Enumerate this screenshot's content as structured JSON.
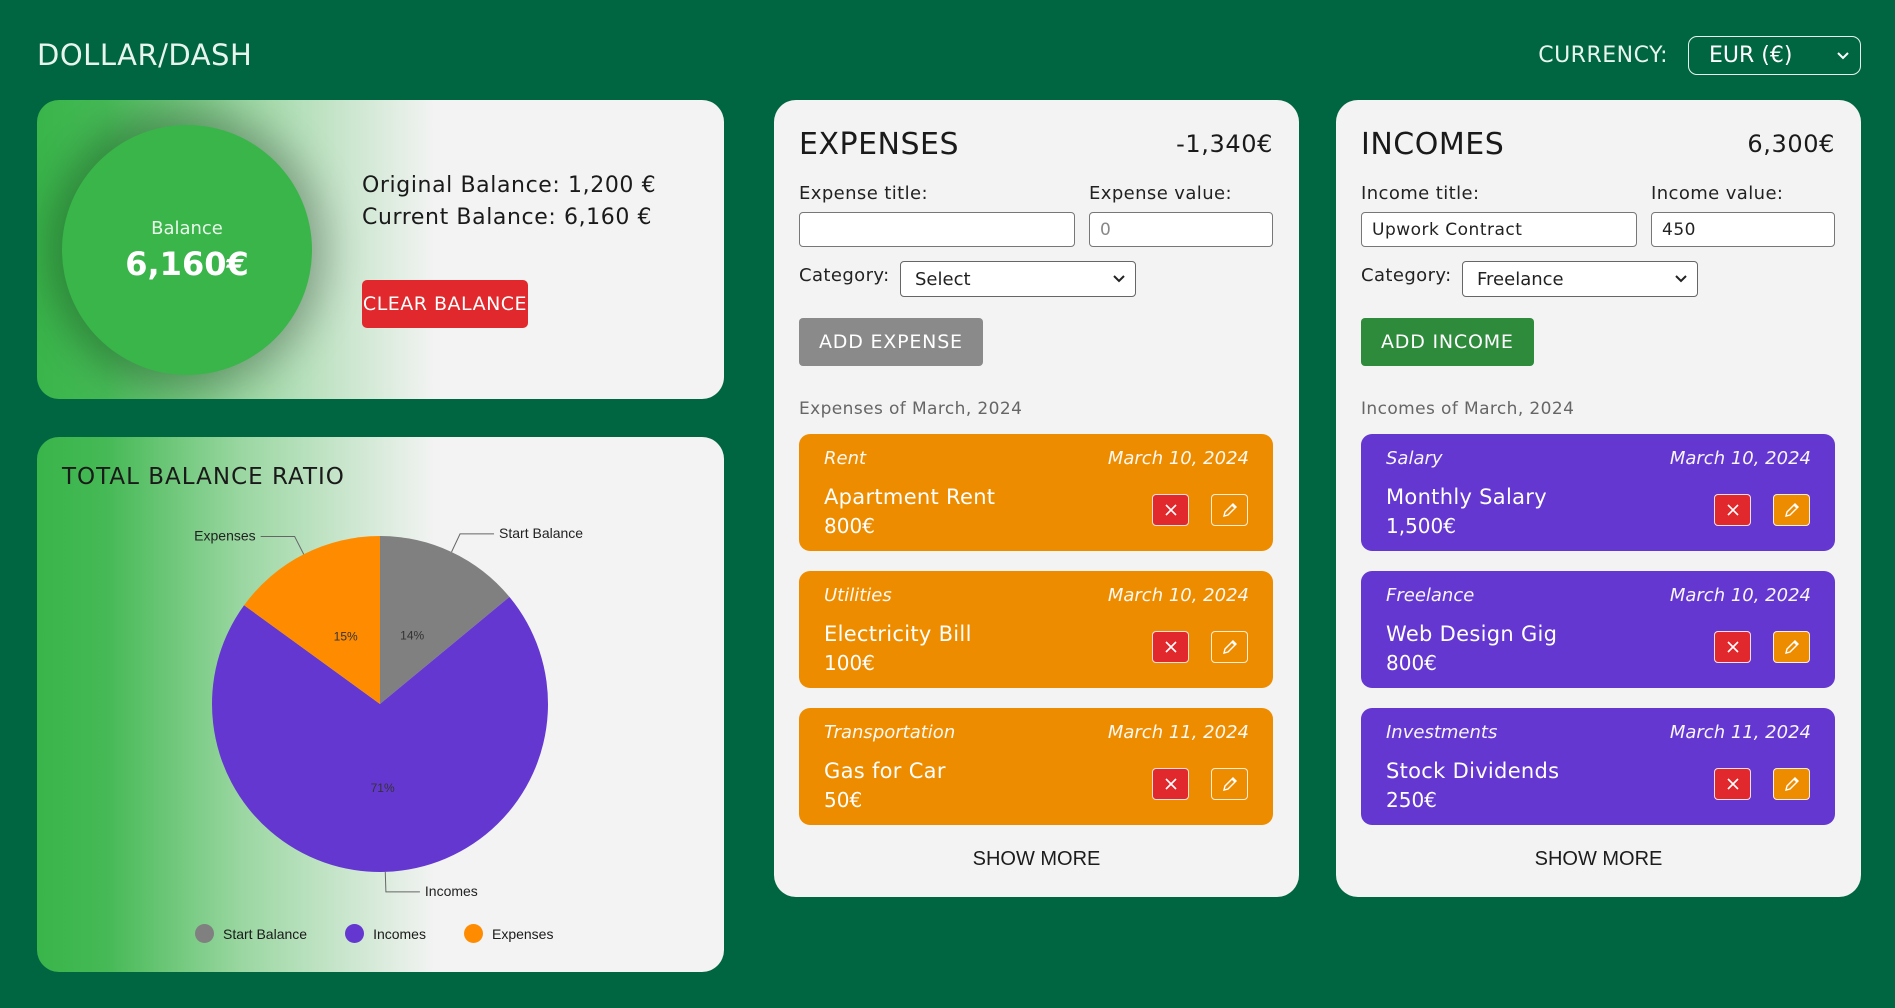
{
  "app": {
    "logo": "DOLLAR/DASH"
  },
  "currency": {
    "label": "CURRENCY:",
    "selected": "EUR (€)"
  },
  "balance": {
    "circle_label": "Balance",
    "circle_value": "6,160€",
    "original_line": "Original Balance: 1,200 €",
    "current_line": "Current Balance: 6,160 €",
    "clear_button": "CLEAR BALANCE",
    "accent_color": "#39b54a"
  },
  "ratio": {
    "title": "TOTAL BALANCE RATIO",
    "legend": [
      "Start Balance",
      "Incomes",
      "Expenses"
    ]
  },
  "chart_data": {
    "type": "pie",
    "title": "TOTAL BALANCE RATIO",
    "labels": [
      "Start Balance",
      "Incomes",
      "Expenses"
    ],
    "values": [
      14,
      71,
      15
    ],
    "value_labels": [
      "14%",
      "71%",
      "15%"
    ],
    "colors": [
      "#808080",
      "#6437d0",
      "#ff8c00"
    ],
    "legend_position": "bottom"
  },
  "expenses": {
    "title": "EXPENSES",
    "total": "-1,340€",
    "title_label": "Expense title:",
    "title_value": "",
    "value_label": "Expense value:",
    "value_placeholder": "0",
    "category_label": "Category:",
    "category_selected": "Select",
    "add_button": "ADD EXPENSE",
    "period": "Expenses of March, 2024",
    "item_color": "#ee8c00",
    "button_color": "#8a8a8a",
    "items": [
      {
        "category": "Rent",
        "date": "March 10, 2024",
        "name": "Apartment Rent",
        "amount": "800€"
      },
      {
        "category": "Utilities",
        "date": "March 10, 2024",
        "name": "Electricity Bill",
        "amount": "100€"
      },
      {
        "category": "Transportation",
        "date": "March 11, 2024",
        "name": "Gas for Car",
        "amount": "50€"
      }
    ],
    "show_more": "SHOW MORE"
  },
  "incomes": {
    "title": "INCOMES",
    "total": "6,300€",
    "title_label": "Income title:",
    "title_value": "Upwork Contract",
    "value_label": "Income value:",
    "value_value": "450",
    "category_label": "Category:",
    "category_selected": "Freelance",
    "add_button": "ADD INCOME",
    "period": "Incomes of March, 2024",
    "item_color": "#6437d0",
    "button_color": "#2e8b3c",
    "items": [
      {
        "category": "Salary",
        "date": "March 10, 2024",
        "name": "Monthly Salary",
        "amount": "1,500€"
      },
      {
        "category": "Freelance",
        "date": "March 10, 2024",
        "name": "Web Design Gig",
        "amount": "800€"
      },
      {
        "category": "Investments",
        "date": "March 11, 2024",
        "name": "Stock Dividends",
        "amount": "250€"
      }
    ],
    "show_more": "SHOW MORE"
  }
}
